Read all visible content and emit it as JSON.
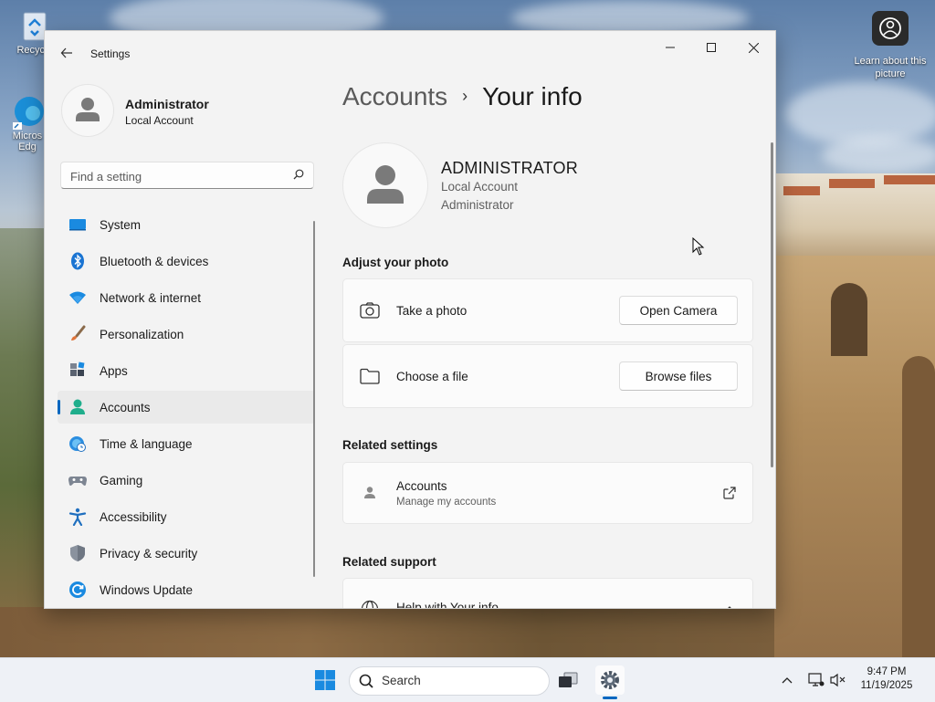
{
  "desktop": {
    "recycle_label": "Recycle",
    "edge_label_1": "Micros",
    "edge_label_2": "Edg",
    "learn_label": "Learn about this picture"
  },
  "window": {
    "title": "Settings",
    "minimize_glyph": "—",
    "maximize_glyph": "☐",
    "close_glyph": "✕"
  },
  "profile": {
    "name": "Administrator",
    "account_type": "Local Account"
  },
  "search": {
    "placeholder": "Find a setting"
  },
  "nav": {
    "items": [
      {
        "label": "System",
        "icon": "system-icon"
      },
      {
        "label": "Bluetooth & devices",
        "icon": "bluetooth-icon"
      },
      {
        "label": "Network & internet",
        "icon": "wifi-icon"
      },
      {
        "label": "Personalization",
        "icon": "brush-icon"
      },
      {
        "label": "Apps",
        "icon": "apps-icon"
      },
      {
        "label": "Accounts",
        "icon": "accounts-icon",
        "active": true
      },
      {
        "label": "Time & language",
        "icon": "globe-clock-icon"
      },
      {
        "label": "Gaming",
        "icon": "gamepad-icon"
      },
      {
        "label": "Accessibility",
        "icon": "accessibility-icon"
      },
      {
        "label": "Privacy & security",
        "icon": "shield-icon"
      },
      {
        "label": "Windows Update",
        "icon": "update-icon"
      }
    ]
  },
  "breadcrumb": {
    "parent": "Accounts",
    "separator": "›",
    "current": "Your info"
  },
  "user": {
    "display_name": "ADMINISTRATOR",
    "account_type": "Local Account",
    "role": "Administrator"
  },
  "adjust_photo": {
    "heading": "Adjust your photo",
    "take_photo_label": "Take a photo",
    "open_camera_button": "Open Camera",
    "choose_file_label": "Choose a file",
    "browse_files_button": "Browse files"
  },
  "related_settings": {
    "heading": "Related settings",
    "accounts_title": "Accounts",
    "accounts_subtitle": "Manage my accounts"
  },
  "related_support": {
    "heading": "Related support",
    "help_label": "Help with Your info"
  },
  "taskbar": {
    "search_label": "Search",
    "time": "9:47 PM",
    "date": "11/19/2025"
  },
  "colors": {
    "accent": "#0067c0"
  }
}
